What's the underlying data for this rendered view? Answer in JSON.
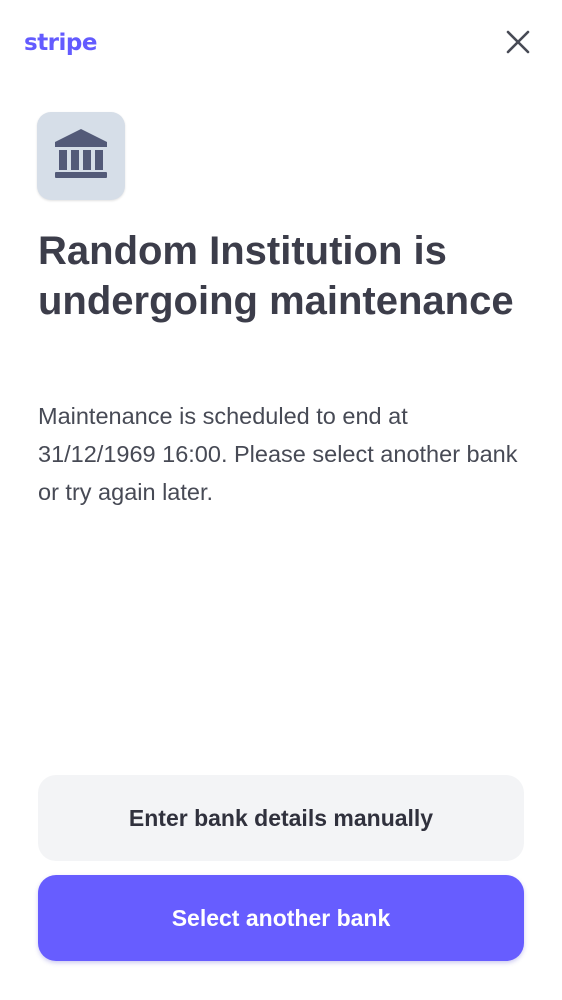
{
  "header": {
    "logo_text": "stripe",
    "close_icon": "close-icon"
  },
  "bank_icon": "bank-icon",
  "title": "Random Institution is undergoing maintenance",
  "body": "Maintenance is scheduled to end at 31/12/1969 16:00. Please select another bank or try again later.",
  "actions": {
    "manual_label": "Enter bank details manually",
    "select_label": "Select another bank"
  },
  "colors": {
    "brand": "#635bff",
    "primary_button": "#675dff",
    "secondary_button": "#f3f4f6",
    "text": "#30313d",
    "icon_tile": "#d6dee8",
    "icon_glyph": "#535a78"
  }
}
